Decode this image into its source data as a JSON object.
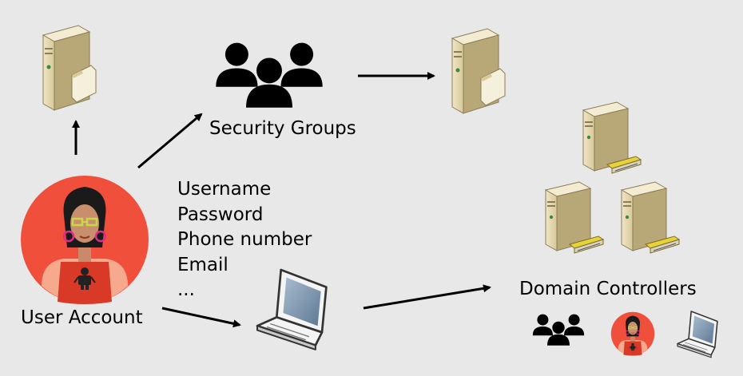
{
  "labels": {
    "security_groups": "Security Groups",
    "user_account": "User Account",
    "domain_controllers": "Domain Controllers"
  },
  "attributes": [
    "Username",
    "Password",
    "Phone number",
    "Email",
    "..."
  ],
  "icons": {
    "server": "server-icon",
    "group": "security-group-icon",
    "user": "user-avatar-icon",
    "laptop": "laptop-icon"
  },
  "colors": {
    "background": "#e8e8e8",
    "avatar_bg": "#ef4f3b",
    "server_body": "#e3d7ae",
    "server_side": "#b8a878",
    "drive_yellow": "#e8d23a",
    "laptop_screen": "#7f9ab4"
  }
}
